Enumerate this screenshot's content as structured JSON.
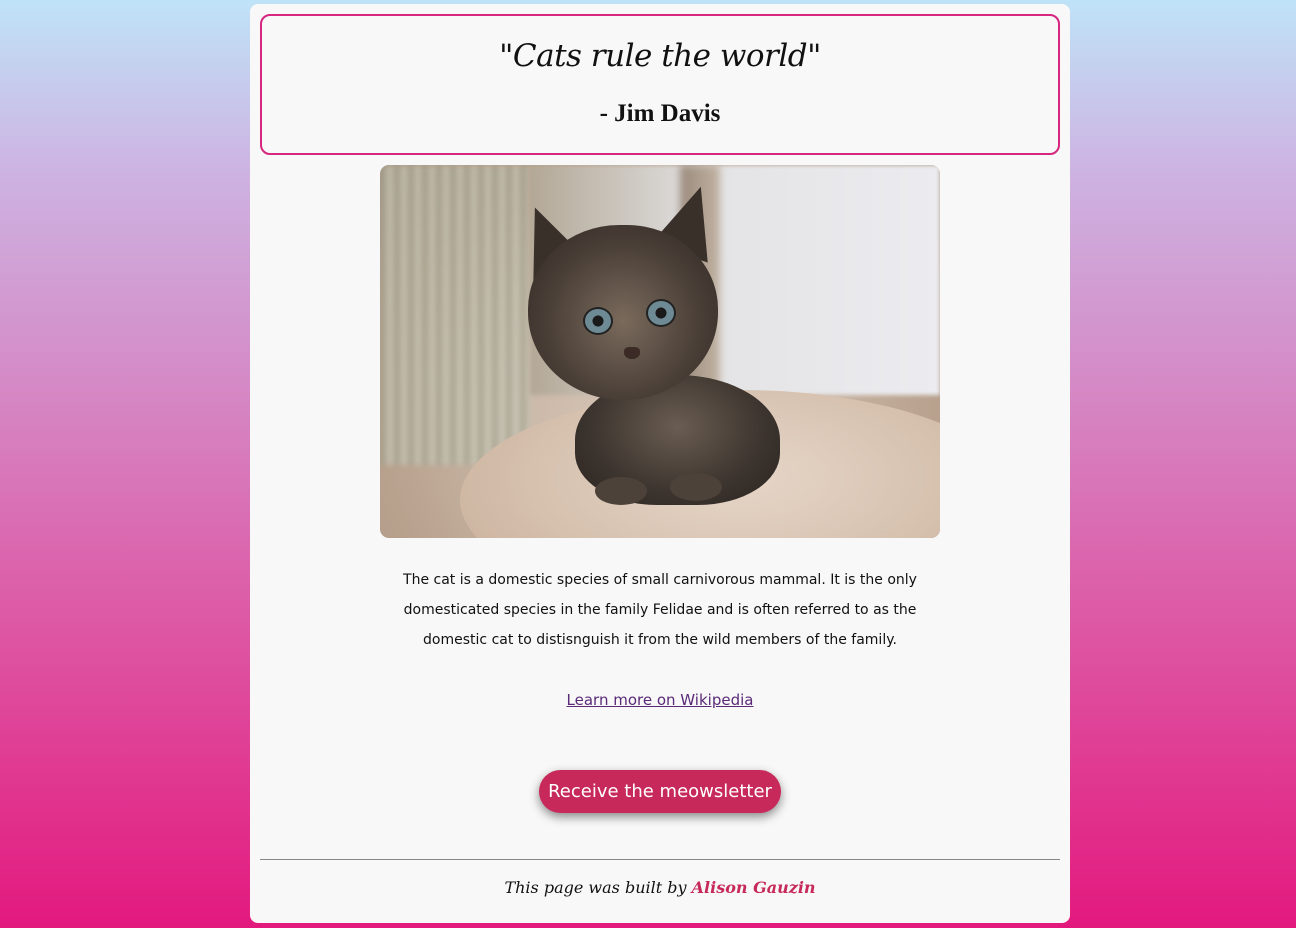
{
  "quote": {
    "text": "\"Cats rule the world\"",
    "author": "- Jim Davis"
  },
  "image": {
    "alt": "Tabby kitten sitting on a cat tree platform"
  },
  "description": {
    "text": "The cat is a domestic species of small carnivorous mammal. It is the only domesticated species in the family Felidae and is often referred to as the domestic cat to distisnguish it from the wild members of the family."
  },
  "link": {
    "label": "Learn more on Wikipedia"
  },
  "cta": {
    "label": "Receive the meowsletter"
  },
  "footer": {
    "prefix": "This page was built by ",
    "author": "Alison Gauzin"
  },
  "colors": {
    "accent": "#c7295a",
    "border": "#d6267f",
    "link": "#5a2a78",
    "card": "#f8f8f8"
  }
}
